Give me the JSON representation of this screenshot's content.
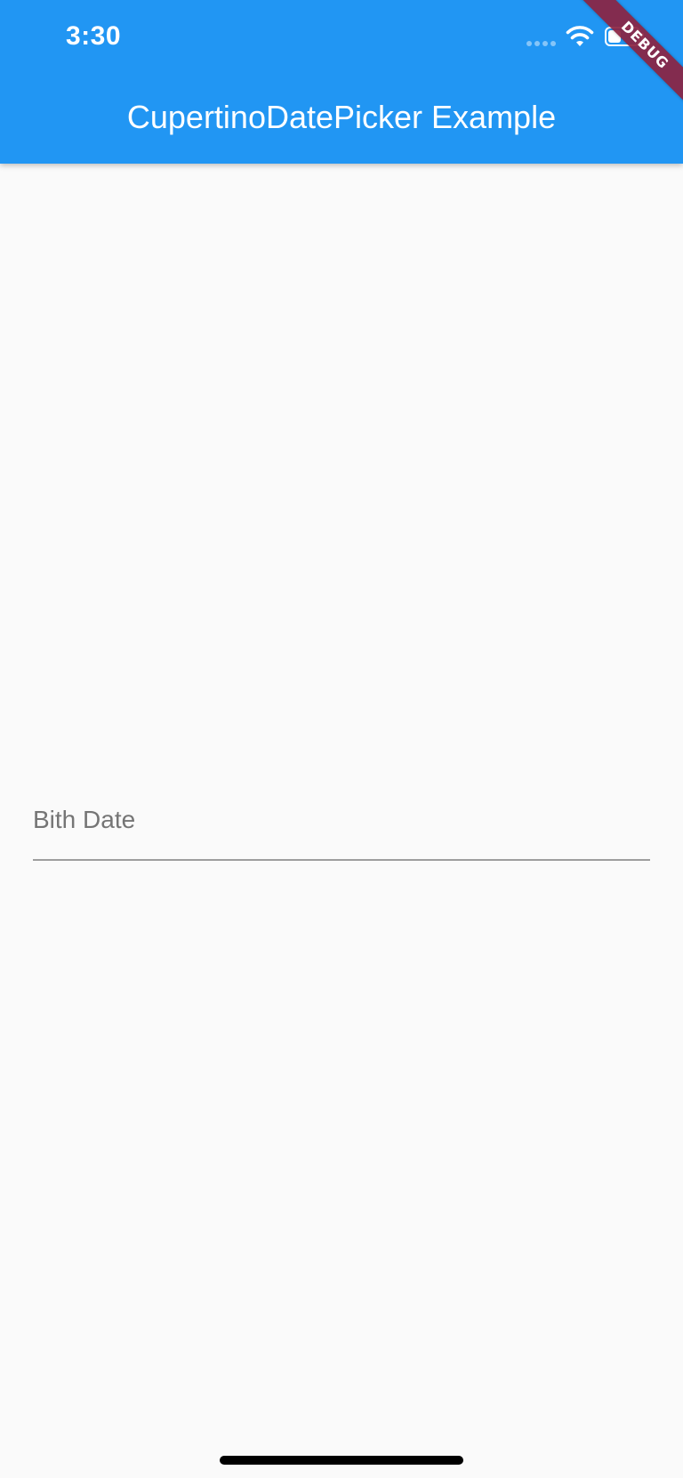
{
  "status_bar": {
    "time": "3:30",
    "icons": [
      "signal-icon",
      "wifi-icon",
      "battery-icon"
    ]
  },
  "app_bar": {
    "title": "CupertinoDatePicker Example",
    "background_color": "#2196f3",
    "title_color": "#ffffff"
  },
  "debug_banner": {
    "label": "DEBUG",
    "color": "#8c2341"
  },
  "form": {
    "birth_date": {
      "placeholder": "Bith Date",
      "value": ""
    }
  },
  "colors": {
    "background": "#fafafa",
    "placeholder": "#757575",
    "underline": "#9e9e9e"
  }
}
